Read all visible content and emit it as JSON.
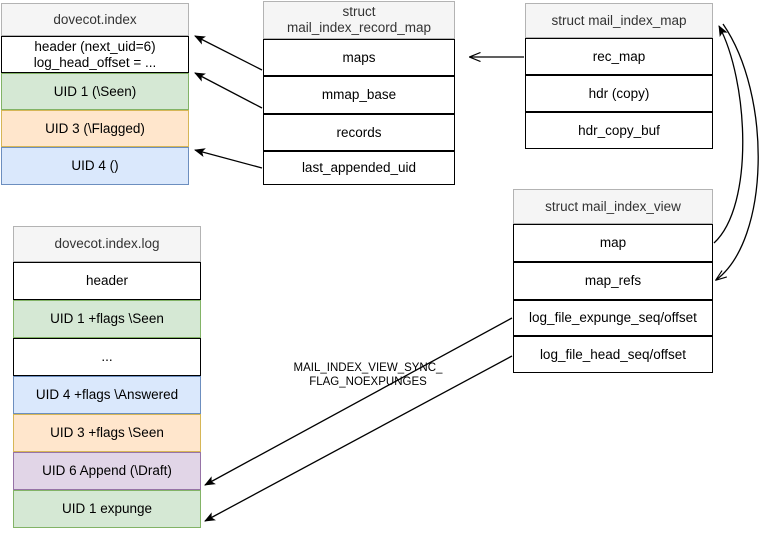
{
  "diagram": {
    "title": "dovecot index / mail_index structures",
    "colors": {
      "green_fill": "#d5e8d4",
      "green_stroke": "#82b366",
      "yellow_fill": "#ffe6cc",
      "yellow_stroke": "#d6b656",
      "blue_fill": "#dae8fc",
      "blue_stroke": "#6c8ebf",
      "purple_fill": "#e1d5e7",
      "purple_stroke": "#9673a6",
      "header_fill": "#f5f5f5",
      "line": "#000000"
    },
    "tables": {
      "dovecot_index": {
        "title": "dovecot.index",
        "rows": [
          "header (next_uid=6)\nlog_head_offset = ...",
          "UID 1 (\\Seen)",
          "UID 3 (\\Flagged)",
          "UID 4 ()"
        ]
      },
      "record_map": {
        "title": "struct\nmail_index_record_map",
        "rows": [
          "maps",
          "mmap_base",
          "records",
          "last_appended_uid"
        ]
      },
      "index_map": {
        "title": "struct mail_index_map",
        "rows": [
          "rec_map",
          "hdr (copy)",
          "hdr_copy_buf"
        ]
      },
      "index_view": {
        "title": "struct mail_index_view",
        "rows": [
          "map",
          "map_refs",
          "log_file_expunge_seq/offset",
          "log_file_head_seq/offset"
        ]
      },
      "dovecot_index_log": {
        "title": "dovecot.index.log",
        "rows": [
          "header",
          "UID 1 +flags \\Seen",
          "...",
          "UID 4 +flags \\Answered",
          "UID 3 +flags \\Seen",
          "UID 6 Append (\\Draft)",
          "UID 1 expunge"
        ]
      }
    },
    "edge_labels": {
      "view_sync_flag": "MAIL_INDEX_VIEW_SYNC_\nFLAG_NOEXPUNGES"
    }
  }
}
